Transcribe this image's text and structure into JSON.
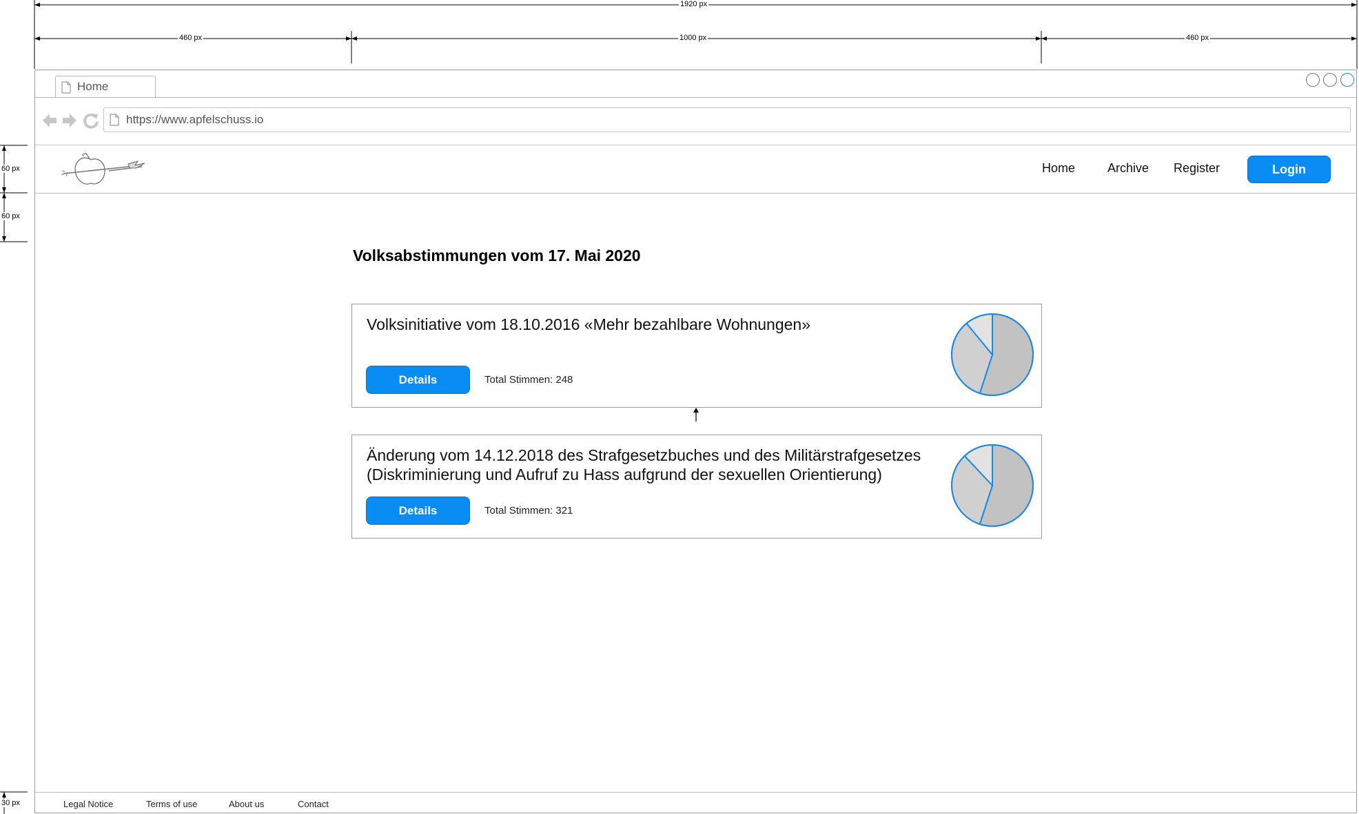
{
  "browser": {
    "tab_label": "Home",
    "url": "https://www.apfelschuss.io"
  },
  "annotations": {
    "total_width": "1920 px",
    "left_width": "460 px",
    "center_width": "1000 px",
    "right_width": "460 px",
    "header_height": "60 px",
    "spacer_height": "60 px",
    "footer_height": "30 px"
  },
  "header": {
    "nav": [
      "Home",
      "Archive",
      "Register"
    ],
    "login_label": "Login"
  },
  "main": {
    "title": "Volksabstimmungen vom 17. Mai 2020",
    "votes": [
      {
        "title": "Volksinitiative vom 18.10.2016 «Mehr bezahlbare Wohnungen»",
        "details_label": "Details",
        "total_label": "Total Stimmen: 248",
        "chart_data": {
          "type": "pie",
          "slices": [
            {
              "value": 55,
              "color": "#c2c2c2"
            },
            {
              "value": 34,
              "color": "#d0d0d0"
            },
            {
              "value": 11,
              "color": "#e2e2e2"
            }
          ]
        }
      },
      {
        "title": "Änderung vom 14.12.2018 des Strafgesetzbuches und des Militärstrafgesetzes (Diskriminierung und Aufruf zu Hass aufgrund der sexuellen Orientierung)",
        "details_label": "Details",
        "total_label": "Total Stimmen: 321",
        "chart_data": {
          "type": "pie",
          "slices": [
            {
              "value": 55,
              "color": "#c2c2c2"
            },
            {
              "value": 33,
              "color": "#d0d0d0"
            },
            {
              "value": 12,
              "color": "#e2e2e2"
            }
          ]
        }
      }
    ]
  },
  "footer": {
    "links": [
      "Legal Notice",
      "Terms of use",
      "About us",
      "Contact"
    ]
  },
  "colors": {
    "accent": "#0a8cf5",
    "pie_stroke": "#1e88e5"
  }
}
